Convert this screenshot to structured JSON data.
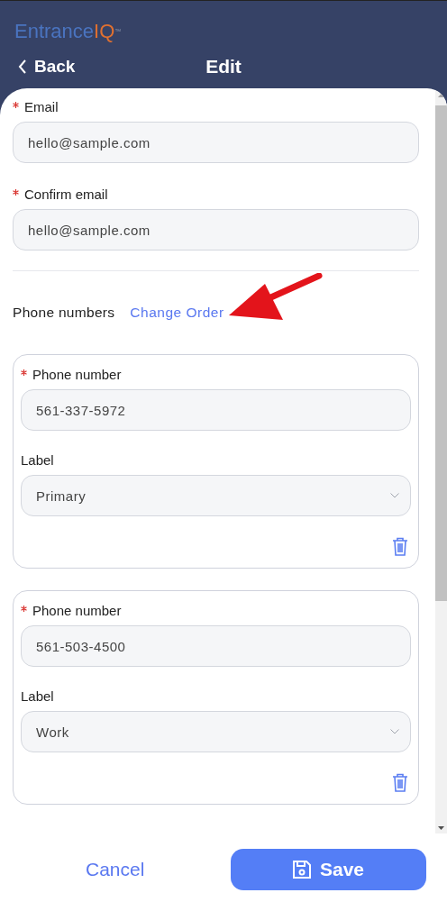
{
  "header": {
    "logo": {
      "main": "Entrance",
      "accent": "IQ",
      "mark": "™"
    },
    "back": "Back",
    "title": "Edit"
  },
  "email_fields": [
    {
      "label": "Email",
      "required": true,
      "value": "hello@sample.com"
    },
    {
      "label": "Confirm email",
      "required": true,
      "value": "hello@sample.com"
    }
  ],
  "phone_section": {
    "label": "Phone numbers",
    "link": "Change Order"
  },
  "phones": [
    {
      "number_label": "Phone number",
      "required": true,
      "number": "561-337-5972",
      "label_label": "Label",
      "label_value": "Primary"
    },
    {
      "number_label": "Phone number",
      "required": true,
      "number": "561-503-4500",
      "label_label": "Label",
      "label_value": "Work"
    }
  ],
  "footer": {
    "cancel": "Cancel",
    "save": "Save"
  }
}
